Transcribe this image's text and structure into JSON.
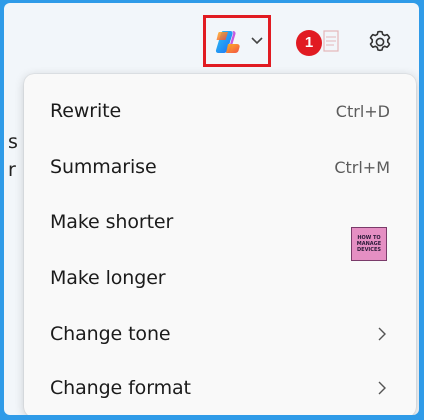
{
  "toolbar": {
    "badge_number": "1"
  },
  "background_text": [
    "s",
    "r"
  ],
  "menu": {
    "items": [
      {
        "label": "Rewrite",
        "shortcut": "Ctrl+D"
      },
      {
        "label": "Summarise",
        "shortcut": "Ctrl+M"
      },
      {
        "label": "Make shorter"
      },
      {
        "label": "Make longer"
      },
      {
        "label": "Change tone"
      },
      {
        "label": "Change format"
      }
    ]
  },
  "watermark": {
    "line1": "HOW TO",
    "line2": "MANAGE",
    "line3": "DEVICES"
  },
  "colors": {
    "highlight_border": "#e11b22",
    "badge": "#e11b22",
    "page_border": "#2f9be8",
    "menu_background": "#f9f9f9"
  },
  "icons": {
    "copilot": "copilot-logo-icon",
    "dropdown": "chevron-down-icon",
    "settings": "gear-icon",
    "submenu": "chevron-right-icon"
  }
}
